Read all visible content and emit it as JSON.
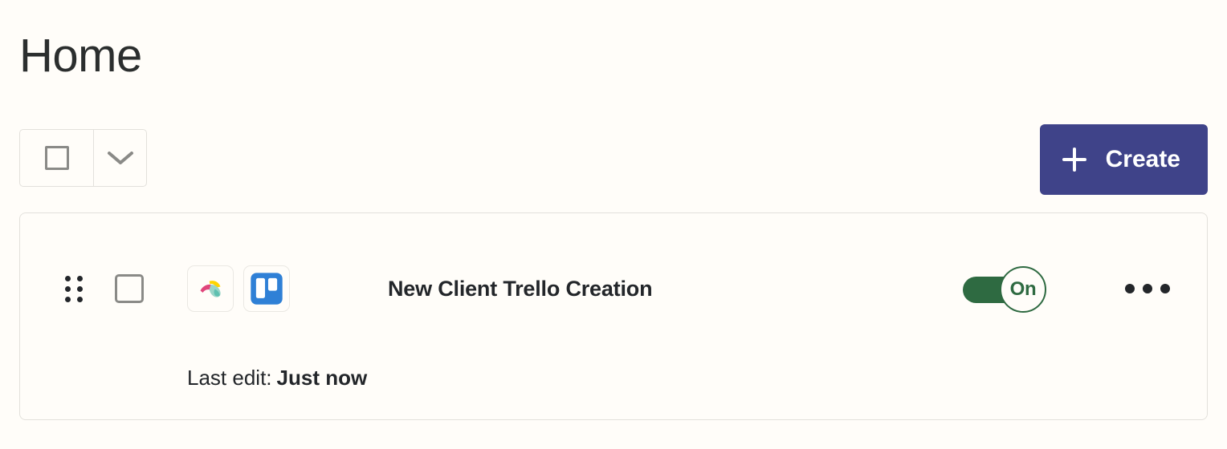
{
  "header": {
    "title": "Home"
  },
  "toolbar": {
    "select_all": {
      "checkbox_icon": "empty-square-icon",
      "checked": false,
      "dropdown_icon": "chevron-down-icon"
    },
    "create_button": {
      "label": "Create",
      "icon": "plus-icon",
      "color": "#3f4389",
      "text_color": "#ffffff"
    }
  },
  "workflows": [
    {
      "drag_handle_icon": "drag-handle-dots-icon",
      "checkbox_icon": "empty-square-icon",
      "checked": false,
      "apps": [
        {
          "name": "jotform-icon",
          "label": "Jotform"
        },
        {
          "name": "trello-icon",
          "label": "Trello"
        }
      ],
      "name": "New Client Trello Creation",
      "toggle": {
        "state_label": "On",
        "enabled": true,
        "color": "#2e6a41"
      },
      "overflow_icon": "more-horizontal-icon",
      "last_edit": {
        "label": "Last edit:",
        "value": "Just now"
      }
    }
  ],
  "colors": {
    "page_background": "#fffdf9",
    "border": "#e3e1dc",
    "text_primary": "#23262a",
    "accent_indigo": "#3f4389",
    "accent_green": "#2e6a41"
  }
}
